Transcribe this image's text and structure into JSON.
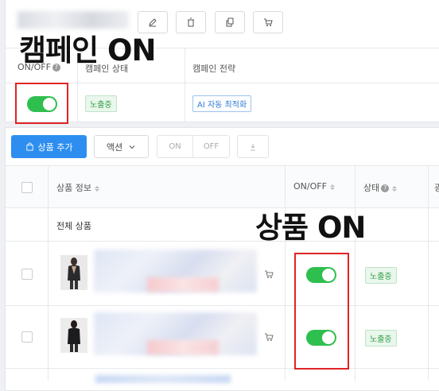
{
  "overlay_labels": {
    "campaign_on": "캠페인 ON",
    "product_on": "상품 ON"
  },
  "campaign_table": {
    "headers": {
      "onoff": "ON/OFF",
      "status": "캠페인 상태",
      "strategy": "캠페인 전략"
    },
    "row": {
      "status": "노출중",
      "strategy": "AI 자동 최적화",
      "toggle_on": true
    }
  },
  "toolbar": {
    "add_product": "상품 추가",
    "action": "액션",
    "on": "ON",
    "off": "OFF"
  },
  "product_table": {
    "headers": {
      "product_info": "상품 정보",
      "onoff": "ON/OFF",
      "status": "상태",
      "next_col": "광"
    },
    "all_products": "전체 상품",
    "rows": [
      {
        "status": "노출중",
        "toggle_on": true
      },
      {
        "status": "노출중",
        "toggle_on": true
      }
    ]
  },
  "colors": {
    "accent": "#2d8ef0",
    "toggle": "#2fbf4f",
    "highlight": "#e02424"
  },
  "icons": [
    "edit-icon",
    "trash-icon",
    "copy-icon",
    "cart-icon",
    "bag-icon",
    "download-icon",
    "chevron-down-icon",
    "help-icon"
  ]
}
